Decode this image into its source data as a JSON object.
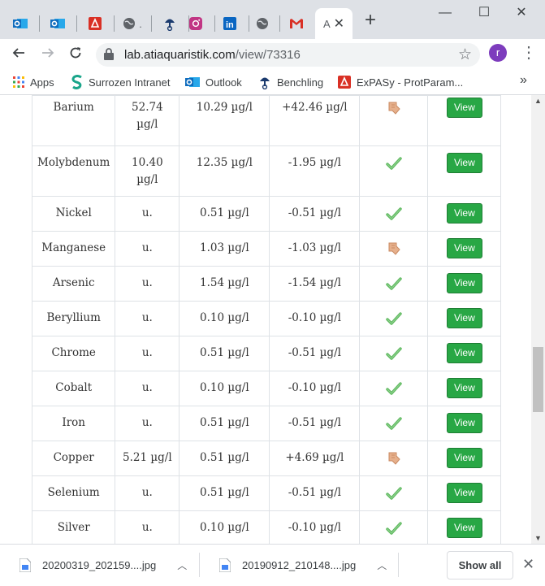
{
  "browser": {
    "tabs": [
      {
        "icon": "outlook-icon",
        "color": "#0f6cbd"
      },
      {
        "icon": "outlook-icon",
        "color": "#0f6cbd"
      },
      {
        "icon": "pdf-icon",
        "color": "#d93025"
      },
      {
        "icon": "globe-icon",
        "color": "#5f6368"
      },
      {
        "icon": "benchling-icon",
        "color": "#1a3a6e"
      },
      {
        "icon": "instagram-icon",
        "color": "#c13584"
      },
      {
        "icon": "linkedin-icon",
        "color": "#0a66c2"
      },
      {
        "icon": "globe-icon",
        "color": "#5f6368"
      },
      {
        "icon": "gmail-icon",
        "color": "#d93025"
      }
    ],
    "active_tab_text": "A",
    "new_tab": "+",
    "window_controls": {
      "minimize": "—",
      "maximize": "☐",
      "close": "✕"
    },
    "url_host": "lab.atiaquaristik.com",
    "url_path": "/view/73316",
    "profile_initial": "r"
  },
  "bookmarks": [
    {
      "label": "Apps",
      "icon": "apps-grid-icon"
    },
    {
      "label": "Surrozen Intranet",
      "icon": "surrozen-s-icon"
    },
    {
      "label": "Outlook",
      "icon": "outlook-icon"
    },
    {
      "label": "Benchling",
      "icon": "benchling-icon"
    },
    {
      "label": "ExPASy - ProtParam...",
      "icon": "pdf-icon"
    }
  ],
  "bookmarks_more": "»",
  "table": {
    "rows": [
      {
        "element": "Barium",
        "measured": "52.74 µg/l",
        "reference": "10.29 µg/l",
        "difference": "+42.46 µg/l",
        "status": "warn",
        "action": "View"
      },
      {
        "element": "Molybdenum",
        "measured": "10.40 µg/l",
        "reference": "12.35 µg/l",
        "difference": "-1.95 µg/l",
        "status": "ok",
        "action": "View"
      },
      {
        "element": "Nickel",
        "measured": "u.",
        "reference": "0.51 µg/l",
        "difference": "-0.51 µg/l",
        "status": "ok",
        "action": "View"
      },
      {
        "element": "Manganese",
        "measured": "u.",
        "reference": "1.03 µg/l",
        "difference": "-1.03 µg/l",
        "status": "warn",
        "action": "View"
      },
      {
        "element": "Arsenic",
        "measured": "u.",
        "reference": "1.54 µg/l",
        "difference": "-1.54 µg/l",
        "status": "ok",
        "action": "View"
      },
      {
        "element": "Beryllium",
        "measured": "u.",
        "reference": "0.10 µg/l",
        "difference": "-0.10 µg/l",
        "status": "ok",
        "action": "View"
      },
      {
        "element": "Chrome",
        "measured": "u.",
        "reference": "0.51 µg/l",
        "difference": "-0.51 µg/l",
        "status": "ok",
        "action": "View"
      },
      {
        "element": "Cobalt",
        "measured": "u.",
        "reference": "0.10 µg/l",
        "difference": "-0.10 µg/l",
        "status": "ok",
        "action": "View"
      },
      {
        "element": "Iron",
        "measured": "u.",
        "reference": "0.51 µg/l",
        "difference": "-0.51 µg/l",
        "status": "ok",
        "action": "View"
      },
      {
        "element": "Copper",
        "measured": "5.21 µg/l",
        "reference": "0.51 µg/l",
        "difference": "+4.69 µg/l",
        "status": "warn",
        "action": "View"
      },
      {
        "element": "Selenium",
        "measured": "u.",
        "reference": "0.51 µg/l",
        "difference": "-0.51 µg/l",
        "status": "ok",
        "action": "View"
      },
      {
        "element": "Silver",
        "measured": "u.",
        "reference": "0.10 µg/l",
        "difference": "-0.10 µg/l",
        "status": "ok",
        "action": "View"
      }
    ]
  },
  "downloads": [
    {
      "filename": "20200319_202159....jpg"
    },
    {
      "filename": "20190912_210148....jpg"
    }
  ],
  "show_all_label": "Show all",
  "colors": {
    "view_button": "#28a745",
    "check": "#5cb85c",
    "warn_hand": "#d9a07a"
  }
}
